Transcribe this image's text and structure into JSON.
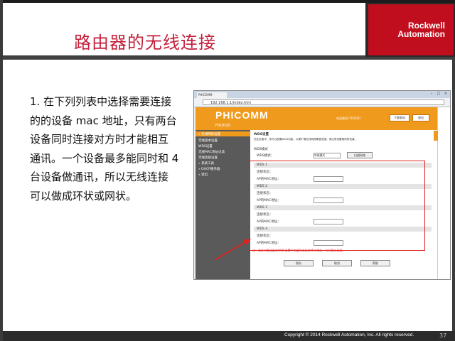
{
  "slide": {
    "title": "路由器的无线连接",
    "logo_line1": "Rockwell",
    "logo_line2": "Automation",
    "body_lines": [
      "1. 在下列列表中选择需要连接",
      "的的设备 mac 地址，只有两台",
      "设备同时连接对方时才能相互",
      "通讯。一个设备最多能同时和 4",
      "台设备做通讯，所以无线连接",
      "可以做成环状或网状。"
    ],
    "footer": "Copyright © 2014 Rockwell Automation, Inc. All rights reserved.",
    "page_number": "37",
    "colors": {
      "title": "#c41e3a",
      "logo_bg": "#c10e1e",
      "annotation": "#e02020"
    }
  },
  "screenshot": {
    "tab_label": "PHICOMM",
    "url": "192.168.1.1/index.htm",
    "brand": "PHICOMM",
    "brand_shadow": "PHICOMM",
    "model": "FIR302D",
    "header_info": "欢迎使用 FIR302D",
    "header_buttons": [
      "下载驱动",
      "退出"
    ],
    "sidebar": [
      "» 无线网络设置",
      "无线基本设置",
      "WDS设置",
      "无线MAC地址过滤",
      "无线高级设置",
      "» 系统工具",
      "» DHCP服务器",
      "» 退出"
    ],
    "section_title": "WDS设置",
    "description": "在此页面中，您可以配置WDS功能，以便扩展无线网络覆盖范围。请注意设置相同的信道。",
    "mode_label": "WDS模式",
    "mode_row_label": "WDS模式：",
    "mode_select": "中继模式",
    "scan_button": "扫描网络",
    "ap_rows": [
      {
        "title": "WDS 1",
        "status": "连接状态：",
        "mac_label": "AP的MAC地址："
      },
      {
        "title": "WDS 2",
        "status": "连接状态：",
        "mac_label": "AP的MAC地址："
      },
      {
        "title": "WDS 3",
        "status": "连接状态：",
        "mac_label": "AP的MAC地址："
      },
      {
        "title": "WDS 4",
        "status": "连接状态：",
        "mac_label": "AP的MAC地址："
      }
    ],
    "note": "注：请在对端设备的WDS设置中也填写本机的MAC地址，方可建立连接。",
    "buttons": [
      "保存",
      "取消",
      "帮助"
    ]
  }
}
